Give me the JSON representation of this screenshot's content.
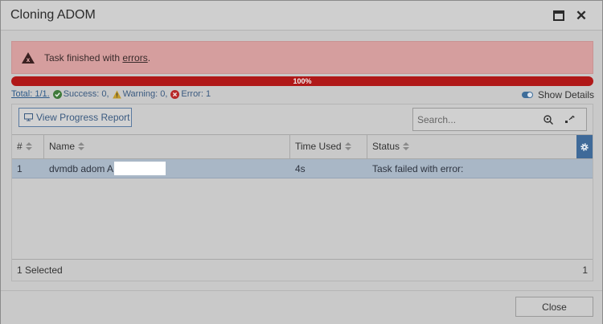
{
  "dialog": {
    "title": "Cloning ADOM"
  },
  "alert": {
    "text_prefix": "Task finished with ",
    "link": "errors",
    "text_suffix": ".",
    "color": "#d59e9e"
  },
  "progress": {
    "label": "100%",
    "value": 1.0,
    "color": "#a61b1b"
  },
  "summary": {
    "total": "Total: 1/1.",
    "success": "Success: 0,",
    "warning": "Warning: 0,",
    "error": "Error: 1"
  },
  "show_details": {
    "label": "Show Details",
    "enabled": true
  },
  "toolbar": {
    "view_progress_label": "View Progress Report",
    "search_placeholder": "Search..."
  },
  "table": {
    "columns": [
      "#",
      "Name",
      "Time Used",
      "Status"
    ],
    "rows": [
      {
        "index": "1",
        "name": "dvmdb adom A",
        "time_used": "4s",
        "status": "Task failed with error:"
      }
    ],
    "footer_selected": "1 Selected",
    "footer_count": "1"
  },
  "actions": {
    "close_label": "Close"
  },
  "icons": {
    "maximize": "maximize-icon",
    "close": "close-icon",
    "alert": "error-triangle-icon",
    "success": "check-circle-icon",
    "warning": "warning-triangle-icon",
    "error": "error-circle-icon",
    "monitor": "monitor-icon",
    "search": "search-icon",
    "clear": "clear-filter-icon",
    "gear": "gear-icon"
  }
}
